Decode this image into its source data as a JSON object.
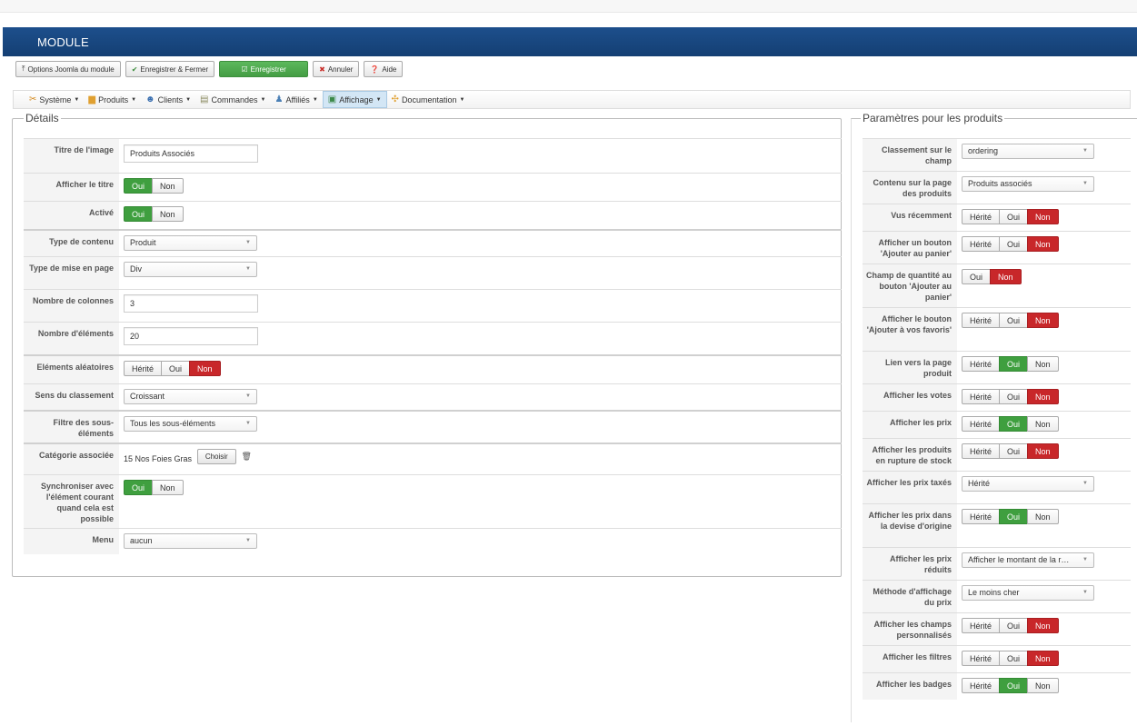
{
  "header": {
    "title": "MODULE"
  },
  "toolbar": {
    "options_label": "Options Joomla du module",
    "save_close_label": "Enregistrer & Fermer",
    "save_label": "Enregistrer",
    "cancel_label": "Annuler",
    "help_label": "Aide"
  },
  "menu": {
    "items": [
      {
        "label": "Système",
        "icon": "wrench-icon"
      },
      {
        "label": "Produits",
        "icon": "box-icon"
      },
      {
        "label": "Clients",
        "icon": "users-icon"
      },
      {
        "label": "Commandes",
        "icon": "cart-icon"
      },
      {
        "label": "Affiliés",
        "icon": "affiliate-icon"
      },
      {
        "label": "Affichage",
        "icon": "display-icon",
        "active": true
      },
      {
        "label": "Documentation",
        "icon": "doc-icon"
      }
    ]
  },
  "details": {
    "legend": "Détails",
    "image_title": {
      "label": "Titre de l'image",
      "value": "Produits Associés"
    },
    "show_title": {
      "label": "Afficher le titre",
      "yes": "Oui",
      "no": "Non",
      "selected": "Oui"
    },
    "active": {
      "label": "Activé",
      "yes": "Oui",
      "no": "Non",
      "selected": "Oui"
    },
    "content_type": {
      "label": "Type de contenu",
      "value": "Produit"
    },
    "layout_type": {
      "label": "Type de mise en page",
      "value": "Div"
    },
    "columns": {
      "label": "Nombre de colonnes",
      "value": "3"
    },
    "items_count": {
      "label": "Nombre d'éléments",
      "value": "20"
    },
    "random": {
      "label": "Eléments aléatoires",
      "inherit": "Hérité",
      "yes": "Oui",
      "no": "Non",
      "selected": "Non"
    },
    "order_dir": {
      "label": "Sens du classement",
      "value": "Croissant"
    },
    "sub_filter": {
      "label": "Filtre des sous-éléments",
      "value": "Tous les sous-éléments"
    },
    "category": {
      "label": "Catégorie associée",
      "value": "15 Nos Foies Gras",
      "choose": "Choisir"
    },
    "sync": {
      "label": "Synchroniser avec l'élément courant quand cela est possible",
      "yes": "Oui",
      "no": "Non",
      "selected": "Oui"
    },
    "menu": {
      "label": "Menu",
      "value": "aucun"
    }
  },
  "params": {
    "legend": "Paramètres pour les produits",
    "rows": [
      {
        "label": "Classement sur le champ",
        "type": "select",
        "value": "ordering"
      },
      {
        "label": "Contenu sur la page des produits",
        "type": "select",
        "value": "Produits associés"
      },
      {
        "label": "Vus récemment",
        "type": "tri",
        "selected": "Non"
      },
      {
        "label": "Afficher un bouton 'Ajouter au panier'",
        "type": "tri",
        "selected": "Non"
      },
      {
        "label": "Champ de quantité au bouton 'Ajouter au panier'",
        "type": "duo",
        "selected": "Non"
      },
      {
        "label": "Afficher le bouton 'Ajouter à vos favoris'",
        "type": "tri",
        "selected": "Non"
      },
      {
        "label": "Lien vers la page produit",
        "type": "tri",
        "selected": "Oui"
      },
      {
        "label": "Afficher les votes",
        "type": "tri",
        "selected": "Non"
      },
      {
        "label": "Afficher les prix",
        "type": "tri",
        "selected": "Oui"
      },
      {
        "label": "Afficher les produits en rupture de stock",
        "type": "tri",
        "selected": "Non"
      },
      {
        "label": "Afficher les prix taxés",
        "type": "select",
        "value": "Hérité"
      },
      {
        "label": "Afficher les prix dans la devise d'origine",
        "type": "tri",
        "selected": "Oui"
      },
      {
        "label": "Afficher les prix réduits",
        "type": "select",
        "value": "Afficher le montant de la r…"
      },
      {
        "label": "Méthode d'affichage du prix",
        "type": "select",
        "value": "Le moins cher"
      },
      {
        "label": "Afficher les champs personnalisés",
        "type": "tri",
        "selected": "Non"
      },
      {
        "label": "Afficher les filtres",
        "type": "tri",
        "selected": "Non"
      },
      {
        "label": "Afficher les badges",
        "type": "tri",
        "selected": "Oui"
      }
    ],
    "inherit": "Hérité",
    "yes": "Oui",
    "no": "Non"
  },
  "colors": {
    "header": "#1d4f8c",
    "green": "#3f9f3f",
    "red": "#c8272a"
  }
}
